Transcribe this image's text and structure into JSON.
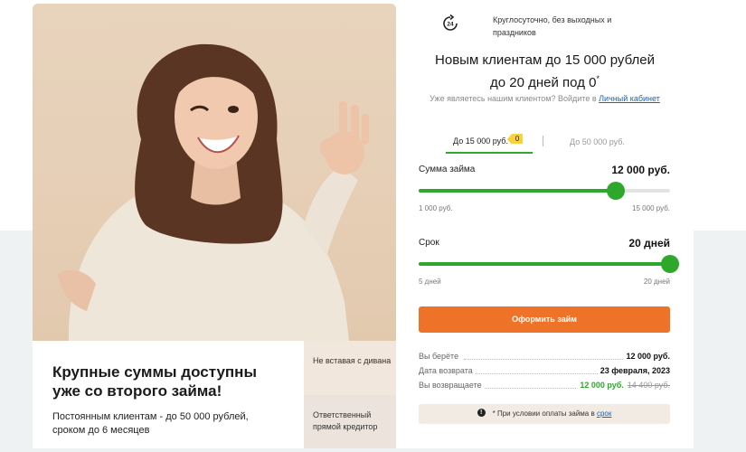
{
  "promo": {
    "title": "Крупные суммы доступны уже со второго займа!",
    "text": "Постоянным клиентам - до 50 000 рублей, сроком до 6 месяцев"
  },
  "side_notes": [
    "Не вставая с дивана",
    "Ответственный прямой кредитор"
  ],
  "header": {
    "icon": "24-hours-icon",
    "hours_text": "Круглосуточно, без выходных и праздников",
    "headline_line1": "Новым клиентам до 15 000 рублей",
    "headline_line2": "до 20 дней под 0",
    "headline_sup": "*",
    "existing_prompt": "Уже являетесь нашим клиентом? Войдите в",
    "cabinet_link": "Личный кабинет"
  },
  "tabs": [
    {
      "label": "До 15 000 руб.",
      "badge": "0",
      "active": true
    },
    {
      "label": "До 50 000 руб.",
      "active": false
    }
  ],
  "amount_slider": {
    "label": "Сумма займа",
    "value_text": "12 000 руб.",
    "min_text": "1 000 руб.",
    "max_text": "15 000 руб.",
    "min": 1000,
    "max": 15000,
    "value": 12000
  },
  "term_slider": {
    "label": "Срок",
    "value_text": "20 дней",
    "min_text": "5 дней",
    "max_text": "20 дней",
    "min": 5,
    "max": 20,
    "value": 20
  },
  "cta_label": "Оформить займ",
  "summary": [
    {
      "key": "Вы берёте",
      "value": "12 000 руб."
    },
    {
      "key": "Дата возврата",
      "value": "23 февраля, 2023"
    },
    {
      "key": "Вы возвращаете",
      "value": "12 000 руб.",
      "old_value": "14 400 руб."
    }
  ],
  "condition": {
    "icon": "info-icon",
    "text": "* При условии оплаты займа в",
    "link": "срок"
  },
  "colors": {
    "accent_green": "#2ea82b",
    "cta_orange": "#ee7328",
    "badge_yellow": "#f7d23e"
  }
}
